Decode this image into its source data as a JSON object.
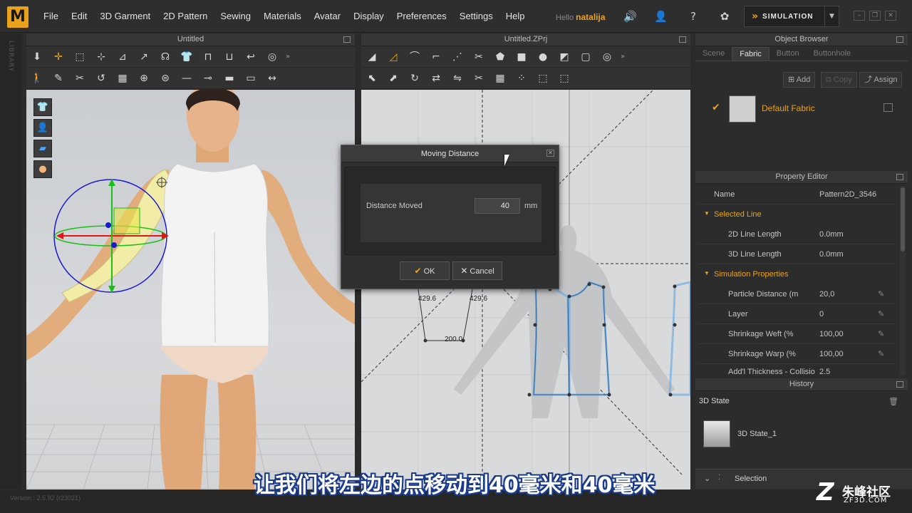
{
  "app": {
    "logo": "M",
    "menu": [
      "File",
      "Edit",
      "3D Garment",
      "2D Pattern",
      "Sewing",
      "Materials",
      "Avatar",
      "Display",
      "Preferences",
      "Settings",
      "Help"
    ],
    "greeting": "Hello",
    "username": "natalija",
    "simulation_label": "SIMULATION",
    "library_label": "LIBRARY"
  },
  "viewport3d": {
    "title": "Untitled"
  },
  "viewport2d": {
    "title": "Untitled.ZPrj",
    "measurements": [
      "429.6",
      "429.6",
      "200.0"
    ]
  },
  "object_browser": {
    "title": "Object Browser",
    "tabs": [
      "Scene",
      "Fabric",
      "Button",
      "Buttonhole"
    ],
    "active_tab": "Fabric",
    "add_label": "Add",
    "copy_label": "Copy",
    "assign_label": "Assign",
    "fabric_name": "Default Fabric"
  },
  "property_editor": {
    "title": "Property Editor",
    "name_key": "Name",
    "name_value": "Pattern2D_3546",
    "selected_line": "Selected Line",
    "line_2d_key": "2D Line Length",
    "line_2d_value": "0.0mm",
    "line_3d_key": "3D Line Length",
    "line_3d_value": "0.0mm",
    "sim_props": "Simulation Properties",
    "particle_key": "Particle Distance (m",
    "particle_value": "20,0",
    "layer_key": "Layer",
    "layer_value": "0",
    "weft_key": "Shrinkage Weft (%",
    "weft_value": "100,00",
    "warp_key": "Shrinkage Warp (%",
    "warp_value": "100,00",
    "addl_key": "Add'l Thickness - Collisio",
    "addl_value": "2,5"
  },
  "history": {
    "title": "History",
    "state_label": "3D State",
    "item_label": "3D State_1",
    "selection_label": "Selection"
  },
  "dialog": {
    "title": "Moving Distance",
    "label": "Distance Moved",
    "value": "40",
    "unit": "mm",
    "ok_label": "OK",
    "cancel_label": "Cancel"
  },
  "status": {
    "version": "Version : 2.5.92     (r23021)"
  },
  "subtitle": "让我们将左边的点移动到40毫米和40毫米",
  "watermark": {
    "logo": "Z",
    "name": "朱峰社区",
    "url": "ZF3D.COM"
  },
  "colors": {
    "accent": "#e9a21c",
    "pattern_line": "#5fa8e6",
    "avatar_fabric": "#f2f2f2"
  }
}
